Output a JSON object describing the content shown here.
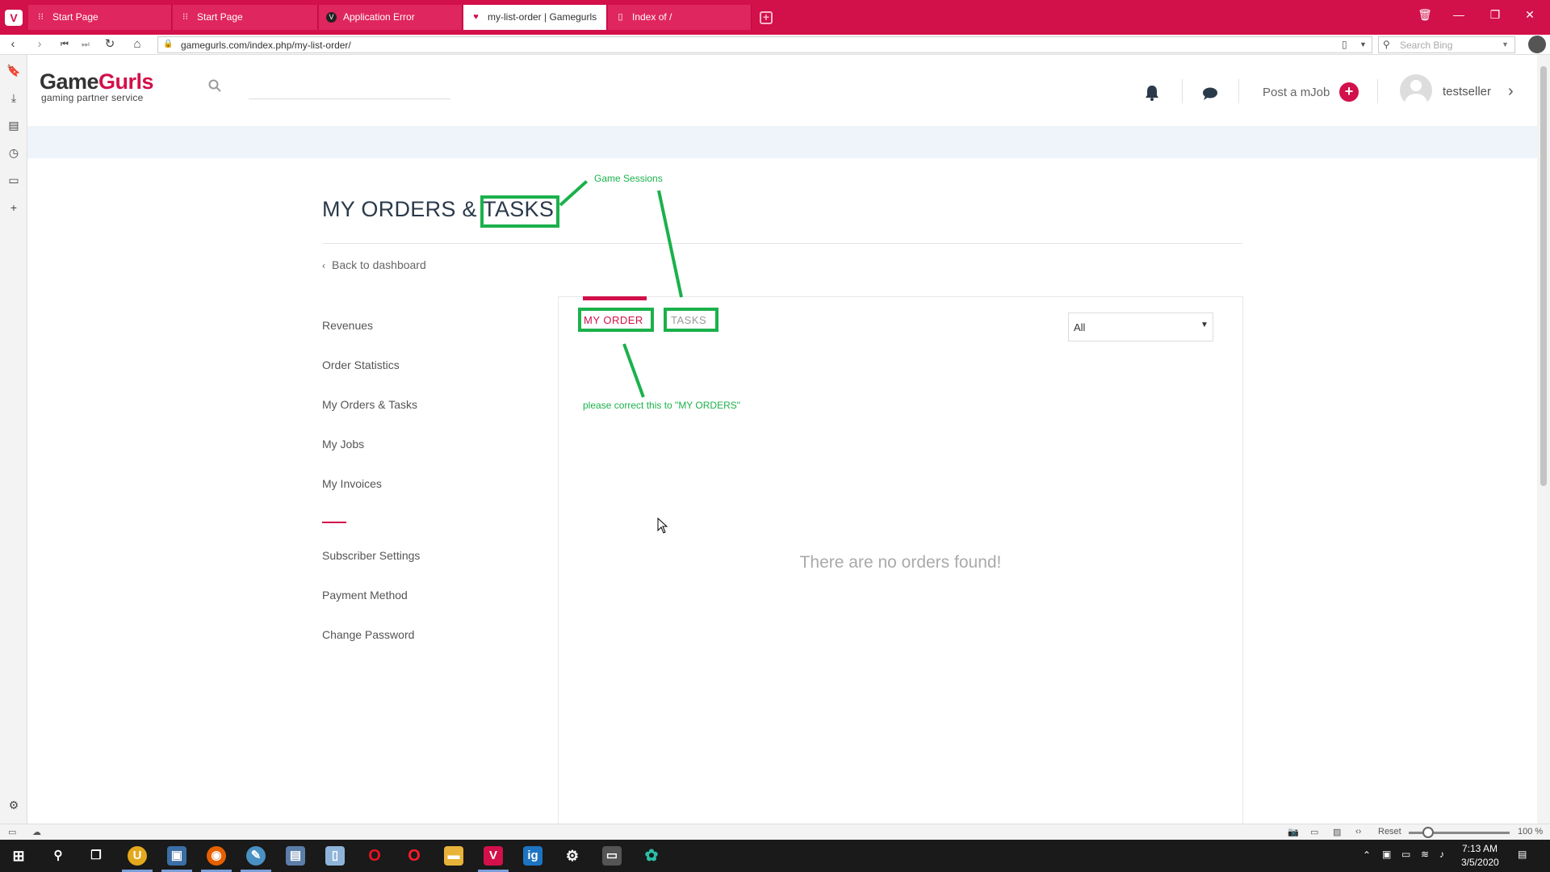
{
  "browser": {
    "tabs": [
      {
        "label": "Start Page",
        "icon": "grid-icon",
        "active": false
      },
      {
        "label": "Start Page",
        "icon": "grid-icon",
        "active": false
      },
      {
        "label": "Application Error",
        "icon": "vivaldi-icon",
        "active": false
      },
      {
        "label": "my-list-order | Gamegurls",
        "icon": "heart-icon",
        "active": true
      },
      {
        "label": "Index of /",
        "icon": "document-icon",
        "active": false
      }
    ],
    "url": "gamegurls.com/index.php/my-list-order/",
    "search_placeholder": "Search Bing",
    "zoom_reset": "Reset",
    "zoom_level": "100 %"
  },
  "site": {
    "logo": {
      "part1": "Game",
      "part2": "Gurls",
      "tagline": "gaming partner service"
    },
    "post_label": "Post a mJob",
    "post_plus": "+",
    "username": "testseller",
    "accent_color": "#d2104a"
  },
  "page": {
    "title": "MY ORDERS & TASKS",
    "back_link": "Back to dashboard",
    "sidebar": {
      "primary": [
        "Revenues",
        "Order Statistics",
        "My Orders & Tasks",
        "My Jobs",
        "My Invoices"
      ],
      "secondary": [
        "Subscriber Settings",
        "Payment Method",
        "Change Password"
      ]
    },
    "tabs": {
      "my_order": "MY ORDER",
      "tasks": "TASKS"
    },
    "filter": {
      "selected": "All"
    },
    "empty_message": "There are no orders found!"
  },
  "annotations": {
    "game_sessions": "Game Sessions",
    "correction": "please correct this to \"MY ORDERS\"",
    "color": "#1bb14b"
  },
  "taskbar": {
    "time": "7:13 AM",
    "date": "3/5/2020"
  }
}
